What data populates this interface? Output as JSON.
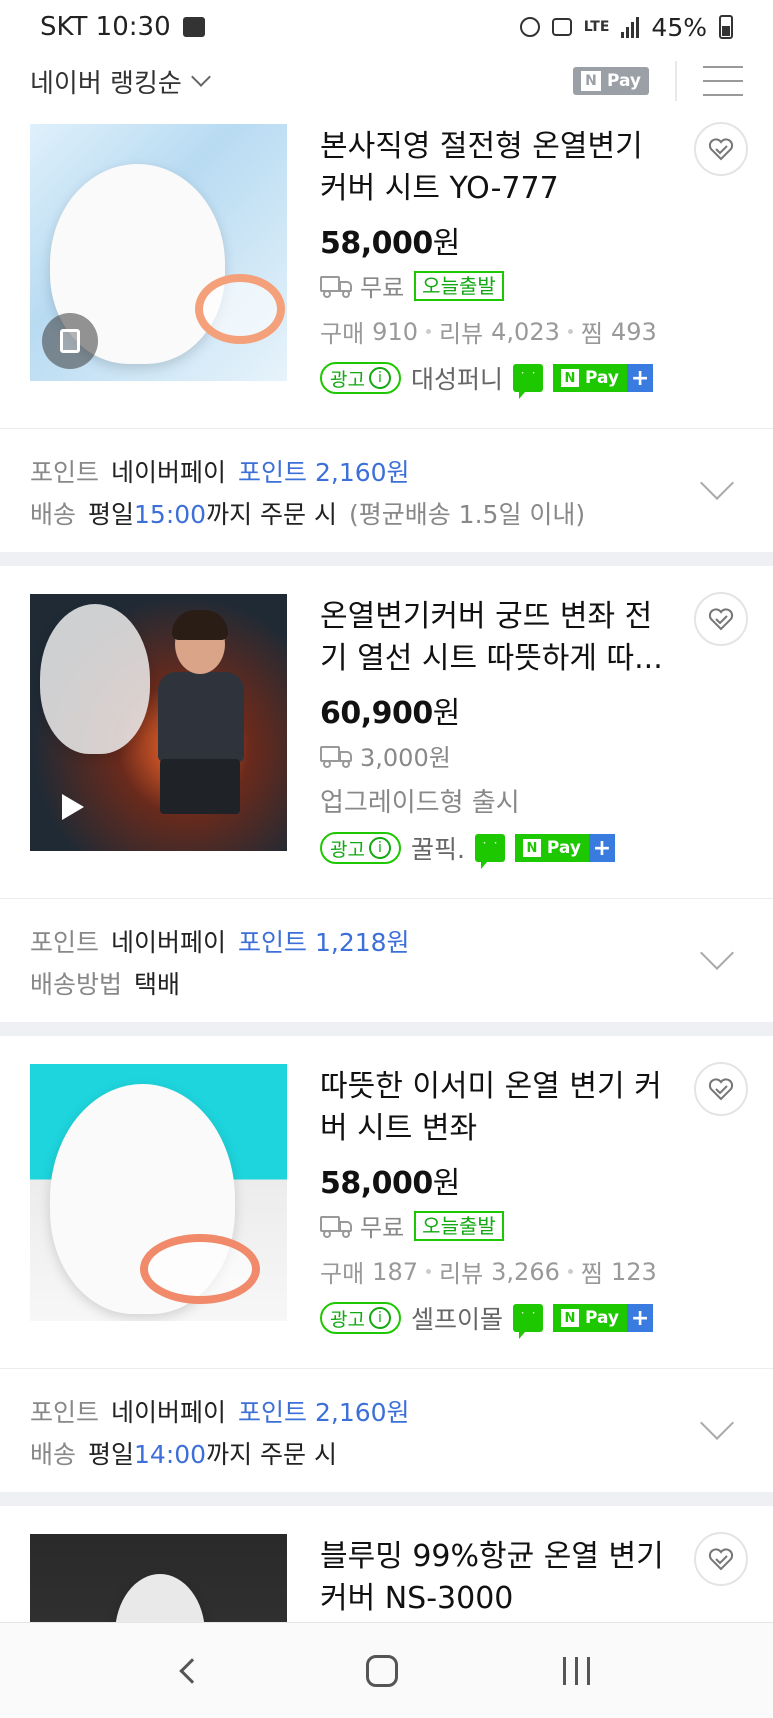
{
  "status": {
    "carrier_time": "SKT 10:30",
    "network": "LTE",
    "battery": "45%"
  },
  "sortbar": {
    "sort_label": "네이버 랭킹순",
    "npay_filter": "Pay",
    "npay_n": "N"
  },
  "common": {
    "won": "원",
    "ad": "광고",
    "info_i": "i",
    "pay": "Pay",
    "pay_n": "N",
    "plus": "+",
    "point_label": "포인트",
    "naverpay": "네이버페이"
  },
  "products": [
    {
      "title": "본사직영 절전형 온열변기커버 시트 YO-777",
      "price": "58,000",
      "shipping": "무료",
      "badge": "오늘출발",
      "stats": {
        "buy_label": "구매",
        "buy": "910",
        "review_label": "리뷰",
        "review": "4,023",
        "zzim_label": "찜",
        "zzim": "493"
      },
      "seller": "대성퍼니",
      "point": "포인트 2,160원",
      "delivery_label": "배송",
      "delivery_day": "평일",
      "delivery_time": "15:00",
      "delivery_suffix": "까지 주문 시",
      "delivery_note": "(평균배송 1.5일 이내)"
    },
    {
      "title": "온열변기커버 궁뜨 변좌 전기 열선 시트 따뜻하게 따...",
      "price": "60,900",
      "shipping": "3,000원",
      "sub": "업그레이드형 출시",
      "seller": "꿀픽.",
      "point": "포인트 1,218원",
      "delivery_label": "배송방법",
      "delivery_value": "택배"
    },
    {
      "title": "따뜻한 이서미 온열 변기 커버 시트 변좌",
      "price": "58,000",
      "shipping": "무료",
      "badge": "오늘출발",
      "stats": {
        "buy_label": "구매",
        "buy": "187",
        "review_label": "리뷰",
        "review": "3,266",
        "zzim_label": "찜",
        "zzim": "123"
      },
      "seller": "셀프이몰",
      "point": "포인트 2,160원",
      "delivery_label": "배송",
      "delivery_day": "평일",
      "delivery_time": "14:00",
      "delivery_suffix": "까지 주문 시"
    },
    {
      "title": "블루밍 99%항균 온열 변기 커버 NS-3000"
    }
  ],
  "colors": {
    "green": "#1ec800",
    "blue": "#3d6fd8",
    "separator": "#eef0f3"
  }
}
